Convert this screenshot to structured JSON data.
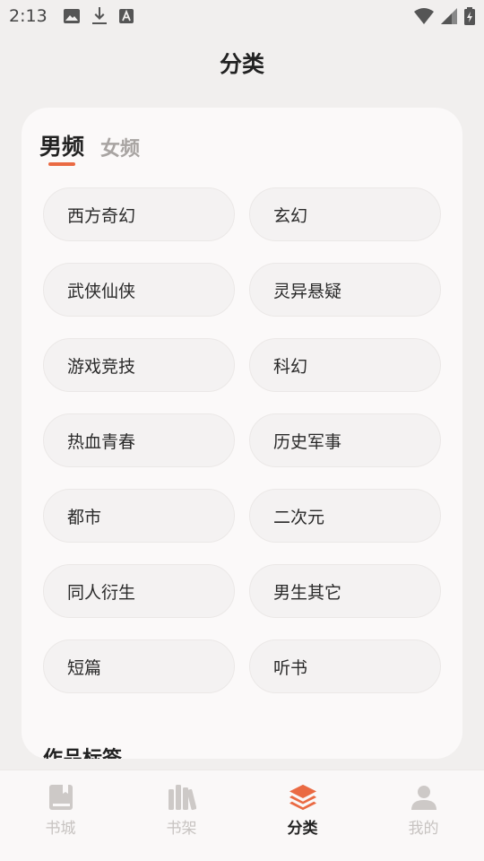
{
  "status_bar": {
    "time": "2:13",
    "left_icons": [
      "image-icon",
      "download-icon",
      "font-icon"
    ],
    "right_icons": [
      "wifi-icon",
      "signal-icon",
      "battery-icon"
    ]
  },
  "header": {
    "title": "分类"
  },
  "gender_tabs": [
    {
      "label": "男频",
      "active": true
    },
    {
      "label": "女频",
      "active": false
    }
  ],
  "categories": [
    "西方奇幻",
    "玄幻",
    "武侠仙侠",
    "灵异悬疑",
    "游戏竞技",
    "科幻",
    "热血青春",
    "历史军事",
    "都市",
    "二次元",
    "同人衍生",
    "男生其它",
    "短篇",
    "听书"
  ],
  "section": {
    "heading": "作品标签"
  },
  "bottom_nav": [
    {
      "label": "书城",
      "icon": "book-icon",
      "active": false
    },
    {
      "label": "书架",
      "icon": "bookshelf-icon",
      "active": false
    },
    {
      "label": "分类",
      "icon": "layers-icon",
      "active": true
    },
    {
      "label": "我的",
      "icon": "person-icon",
      "active": false
    }
  ],
  "colors": {
    "accent": "#ea6a43",
    "background": "#f1efee",
    "card": "#fbf9f9",
    "inactive": "#c7c3c1"
  }
}
